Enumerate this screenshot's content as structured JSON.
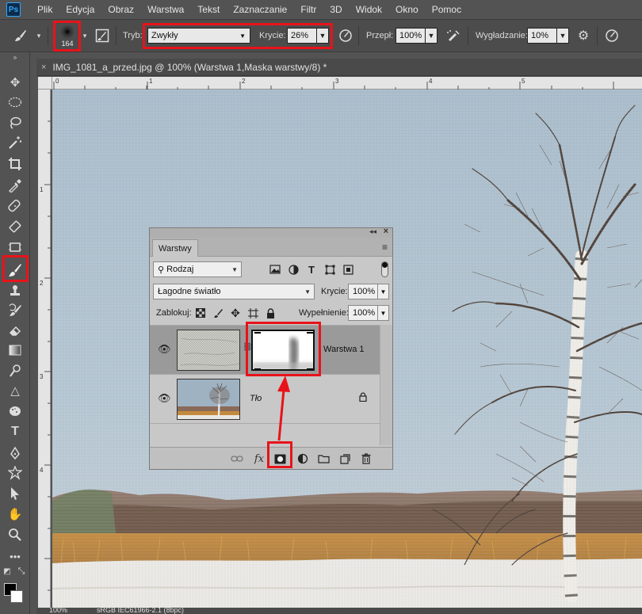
{
  "app": {
    "logo": "Ps"
  },
  "menu": [
    "Plik",
    "Edycja",
    "Obraz",
    "Warstwa",
    "Tekst",
    "Zaznaczanie",
    "Filtr",
    "3D",
    "Widok",
    "Okno",
    "Pomoc"
  ],
  "options": {
    "brush_size": "164",
    "mode_label": "Tryb:",
    "mode_value": "Zwykły",
    "opacity_label": "Krycie:",
    "opacity_value": "26%",
    "flow_label": "Przepł:",
    "flow_value": "100%",
    "smoothing_label": "Wygładzanie:",
    "smoothing_value": "10%"
  },
  "document": {
    "title": "IMG_1081_a_przed.jpg @ 100% (Warstwa 1,Maska warstwy/8) *",
    "close_glyph": "×",
    "ruler_h": [
      "0",
      "1",
      "2",
      "3",
      "4",
      "5"
    ],
    "ruler_v": [
      "1",
      "2",
      "3",
      "4"
    ],
    "status_zoom": "100%",
    "status_profile": "sRGB IEC61966-2.1 (8bpc)"
  },
  "layers_panel": {
    "tab_label": "Warstwy",
    "filter_value": "Rodzaj",
    "blend_mode": "Łagodne światło",
    "opacity_label": "Krycie:",
    "opacity_value": "100%",
    "lock_label": "Zablokuj:",
    "fill_label": "Wypełnienie:",
    "fill_value": "100%",
    "layers": [
      {
        "name": "Warstwa 1",
        "visible": true
      },
      {
        "name": "Tło",
        "visible": true,
        "locked": true
      }
    ],
    "fx_label": "fx"
  },
  "highlight_color": "#e8131a"
}
